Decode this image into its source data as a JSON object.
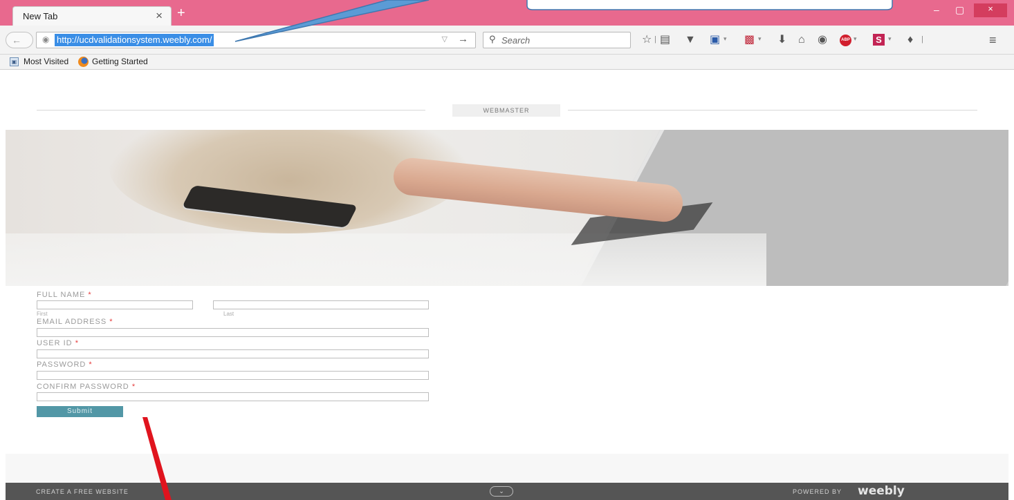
{
  "browser": {
    "tab_title": "New Tab",
    "tab_close_glyph": "×",
    "new_tab_glyph": "+",
    "window_controls": {
      "minimize": "–",
      "maximize": "▢",
      "close": "×"
    },
    "url": "http://ucdvalidationsystem.weebly.com/",
    "search_placeholder": "Search",
    "bookmarks": [
      {
        "label": "Most Visited",
        "icon": "most-visited-icon"
      },
      {
        "label": "Getting Started",
        "icon": "firefox-icon"
      }
    ],
    "toolbar_icons": [
      "bookmark-star-icon",
      "reading-list-icon",
      "pocket-icon",
      "save-icon",
      "addon-icon",
      "download-icon",
      "home-icon",
      "chat-icon",
      "adblock-icon",
      "s-addon-icon",
      "extension-icon",
      "menu-icon"
    ],
    "abp_label": "ABP",
    "s_label": "S"
  },
  "site": {
    "title": "WEBMASTER",
    "hero_icon": "hero-photo-laptop"
  },
  "form": {
    "full_name": "FULL NAME",
    "first": "First",
    "last": "Last",
    "email": "EMAIL ADDRESS",
    "user_id": "USER ID",
    "password": "PASSWORD",
    "confirm_password": "CONFIRM PASSWORD",
    "required_mark": "*",
    "submit": "Submit"
  },
  "footer": {
    "left": "CREATE A FREE WEBSITE",
    "chevron": "⌄",
    "powered_by": "POWERED BY",
    "brand": "weebly"
  },
  "colors": {
    "tabstrip": "#e8698e",
    "url_highlight": "#3a8ee6",
    "submit": "#5297a6",
    "footer": "#555555",
    "annotation_arrow": "#e0141e",
    "callout": "#5b9bd5"
  }
}
